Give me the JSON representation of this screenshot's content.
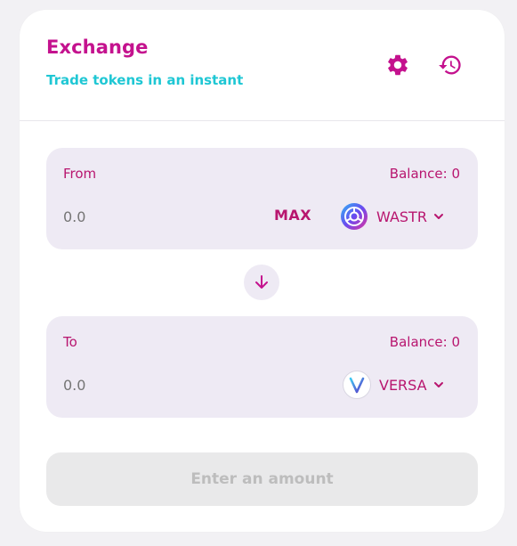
{
  "header": {
    "title": "Exchange",
    "subtitle": "Trade tokens in an instant"
  },
  "icons": {
    "settings": "gear-icon",
    "history": "history-icon",
    "swap": "arrow-down-icon",
    "chevron": "chevron-down-icon"
  },
  "from": {
    "label": "From",
    "balance": "Balance: 0",
    "amount_placeholder": "0.0",
    "max_label": "MAX",
    "token": "WASTR"
  },
  "to": {
    "label": "To",
    "balance": "Balance: 0",
    "amount_placeholder": "0.0",
    "token": "VERSA"
  },
  "submit": {
    "label": "Enter an amount"
  },
  "colors": {
    "primary": "#c4128e",
    "accent": "#1fc7d4",
    "panel": "#eeeaf4",
    "disabled_bg": "#e9e9ea",
    "disabled_text": "#bdbdbd"
  }
}
